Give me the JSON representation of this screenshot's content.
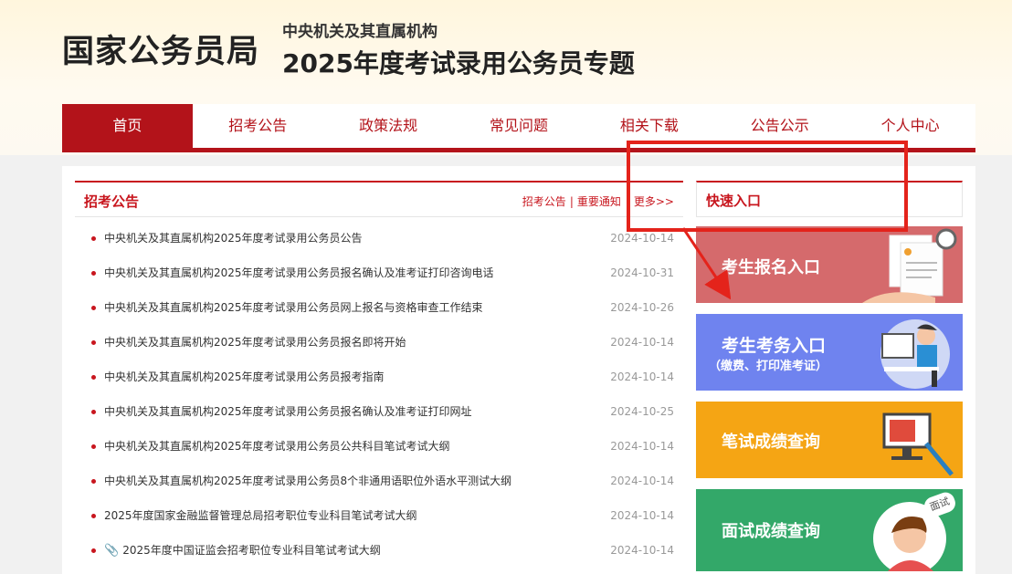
{
  "header": {
    "logo": "国家公务员局",
    "subtitle": "中央机关及其直属机构",
    "title": "2025年度考试录用公务员专题"
  },
  "nav": {
    "items": [
      {
        "label": "首页",
        "active": true
      },
      {
        "label": "招考公告"
      },
      {
        "label": "政策法规"
      },
      {
        "label": "常见问题"
      },
      {
        "label": "相关下载"
      },
      {
        "label": "公告公示"
      },
      {
        "label": "个人中心"
      }
    ]
  },
  "news": {
    "title": "招考公告",
    "link1": "招考公告",
    "sep": "|",
    "link2": "重要通知",
    "more": "更多>>",
    "items": [
      {
        "text": "中央机关及其直属机构2025年度考试录用公务员公告",
        "date": "2024-10-14"
      },
      {
        "text": "中央机关及其直属机构2025年度考试录用公务员报名确认及准考证打印咨询电话",
        "date": "2024-10-31"
      },
      {
        "text": "中央机关及其直属机构2025年度考试录用公务员网上报名与资格审查工作结束",
        "date": "2024-10-26"
      },
      {
        "text": "中央机关及其直属机构2025年度考试录用公务员报名即将开始",
        "date": "2024-10-14"
      },
      {
        "text": "中央机关及其直属机构2025年度考试录用公务员报考指南",
        "date": "2024-10-14"
      },
      {
        "text": "中央机关及其直属机构2025年度考试录用公务员报名确认及准考证打印网址",
        "date": "2024-10-25"
      },
      {
        "text": "中央机关及其直属机构2025年度考试录用公务员公共科目笔试考试大纲",
        "date": "2024-10-14"
      },
      {
        "text": "中央机关及其直属机构2025年度考试录用公务员8个非通用语职位外语水平测试大纲",
        "date": "2024-10-14"
      },
      {
        "text": "2025年度国家金融监督管理总局招考职位专业科目笔试考试大纲",
        "date": "2024-10-14"
      },
      {
        "text": "2025年度中国证监会招考职位专业科目笔试考试大纲",
        "date": "2024-10-14"
      }
    ]
  },
  "quick": {
    "title": "快速入口",
    "card1": "考生报名入口",
    "card2_line1": "考生考务入口",
    "card2_line2": "（缴费、打印准考证）",
    "card3": "笔试成绩查询",
    "card4": "面试成绩查询",
    "card4_badge": "面试"
  },
  "colors": {
    "brand_red": "#b3131a",
    "highlight": "#e4231b"
  }
}
